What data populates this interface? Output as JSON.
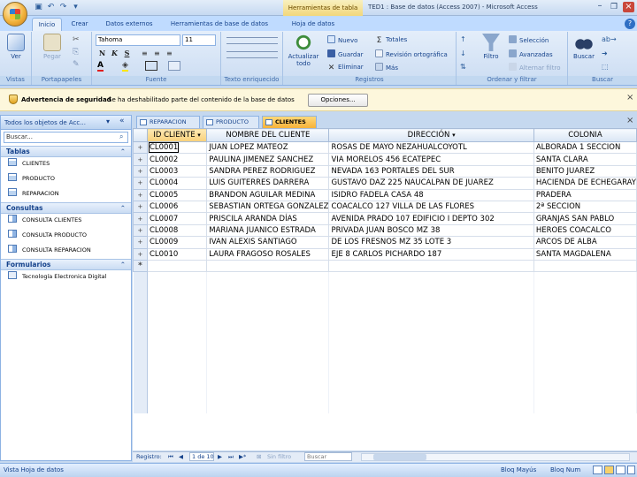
{
  "window": {
    "contextual_tab_group": "Herramientas de tabla",
    "title": "TED1 : Base de datos (Access 2007) - Microsoft Access"
  },
  "ribbon": {
    "tabs": [
      "Inicio",
      "Crear",
      "Datos externos",
      "Herramientas de base de datos",
      "Hoja de datos"
    ],
    "groups": [
      "Vistas",
      "Portapapeles",
      "Fuente",
      "Texto enriquecido",
      "Registros",
      "Ordenar y filtrar",
      "Buscar"
    ],
    "views": {
      "ver": "Ver"
    },
    "clipboard": {
      "pegar": "Pegar"
    },
    "font": {
      "name": "Tahoma",
      "size": "11"
    },
    "records": {
      "actualizar": "Actualizar todo",
      "nuevo": "Nuevo",
      "guardar": "Guardar",
      "eliminar": "Eliminar",
      "totales": "Totales",
      "revision": "Revisión ortográfica",
      "mas": "Más"
    },
    "sort_filter": {
      "filtro": "Filtro",
      "seleccion": "Selección",
      "avanzadas": "Avanzadas",
      "alternar": "Alternar filtro"
    },
    "find": {
      "buscar": "Buscar"
    }
  },
  "security": {
    "warning": "Advertencia de seguridad",
    "message": "Se ha deshabilitado parte del contenido de la base de datos",
    "options_button": "Opciones..."
  },
  "nav_pane": {
    "header": "Todos los objetos de Acc...",
    "search_placeholder": "Buscar...",
    "groups": [
      {
        "label": "Tablas",
        "items": [
          "CLIENTES",
          "PRODUCTO",
          "REPARACION"
        ]
      },
      {
        "label": "Consultas",
        "items": [
          "CONSULTA CLIENTES",
          "CONSULTA PRODUCTO",
          "CONSULTA REPARACION"
        ]
      },
      {
        "label": "Formularios",
        "items": [
          "Tecnología Electronica Digital"
        ]
      }
    ]
  },
  "doc_tabs": [
    "REPARACION",
    "PRODUCTO",
    "CLIENTES"
  ],
  "datasheet": {
    "columns": [
      "ID CLIENTE",
      "NOMBRE DEL CLIENTE",
      "DIRECCIÓN",
      "COLONIA"
    ],
    "rows": [
      [
        "CL0001",
        "JUAN LOPEZ MATEOZ",
        "ROSAS DE MAYO NEZAHUALCOYOTL",
        "ALBORADA 1 SECCION"
      ],
      [
        "CL0002",
        "PAULINA JIMENEZ SANCHEZ",
        "VIA MORELOS 456 ECATEPEC",
        "SANTA CLARA"
      ],
      [
        "CL0003",
        "SANDRA PEREZ RODRIGUEZ",
        "NEVADA 163 PORTALES DEL SUR",
        "BENITO JUAREZ"
      ],
      [
        "CL0004",
        "LUIS GUITERRES DARRERA",
        "GUSTAVO DAZ 225 NAUCALPAN DE JUAREZ",
        "HACIENDA DE ECHEGARAY"
      ],
      [
        "CL0005",
        "BRANDON AGUILAR MEDINA",
        "ISIDRO FADELA CASA 48",
        "PRADERA"
      ],
      [
        "CL0006",
        "SEBASTIAN ORTEGA GONZALEZ",
        "COACALCO 127 VILLA DE LAS FLORES",
        "2ª SECCION"
      ],
      [
        "CL0007",
        "PRISCILA ARANDA DÍAS",
        "AVENIDA PRADO 107 EDIFICIO I DEPTO 302",
        "GRANJAS SAN PABLO"
      ],
      [
        "CL0008",
        "MARIANA JUANICO ESTRADA",
        "PRIVADA JUAN BOSCO MZ 38",
        "HEROES COACALCO"
      ],
      [
        "CL0009",
        "IVAN ALEXIS SANTIAGO",
        "DE LOS FRESNOS MZ 35 LOTE 3",
        "ARCOS DE ALBA"
      ],
      [
        "CL0010",
        "LAURA FRAGOSO ROSALES",
        "EJE 8 CARLOS PICHARDO 187",
        "SANTA MAGDALENA"
      ]
    ],
    "new_row_marker": "*",
    "expand_marker": "+"
  },
  "record_nav": {
    "label": "Registro:",
    "position": "1 de 10",
    "filter": "Sin filtro",
    "search": "Buscar"
  },
  "status": {
    "left": "Vista Hoja de datos",
    "caps": "Bloq Mayús",
    "num": "Bloq Num"
  }
}
